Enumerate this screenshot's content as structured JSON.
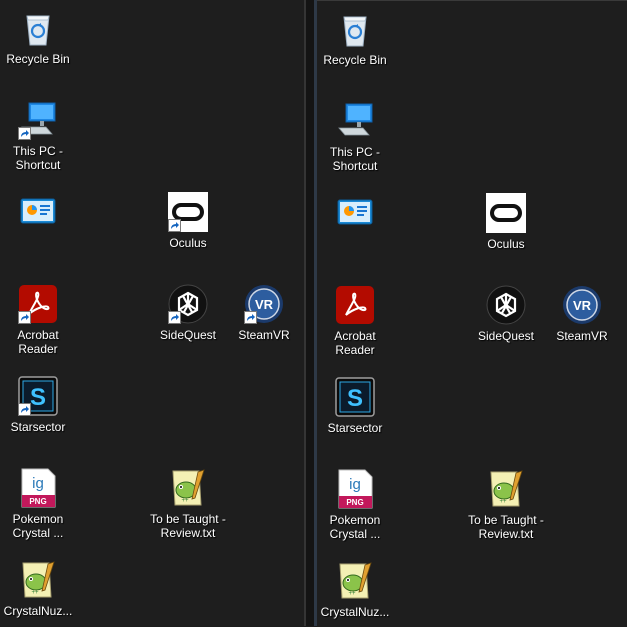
{
  "desktop_left": {
    "icons": [
      {
        "label": "Recycle Bin",
        "icon": "recycle-bin-icon"
      },
      {
        "label": "This PC - Shortcut",
        "icon": "this-pc-icon"
      },
      {
        "label": "",
        "icon": "control-panel-icon"
      },
      {
        "label": "Oculus",
        "icon": "oculus-icon"
      },
      {
        "label": "Acrobat Reader",
        "icon": "acrobat-reader-icon"
      },
      {
        "label": "SideQuest",
        "icon": "sidequest-icon"
      },
      {
        "label": "SteamVR",
        "icon": "steamvr-icon"
      },
      {
        "label": "Starsector",
        "icon": "starsector-icon"
      },
      {
        "label": "Pokemon Crystal ...",
        "icon": "png-file-icon"
      },
      {
        "label": "To be Taught - Review.txt",
        "icon": "notepad-plus-plus-icon"
      },
      {
        "label": "CrystalNuz...",
        "icon": "notepad-plus-plus-icon"
      }
    ]
  },
  "desktop_right": {
    "icons": [
      {
        "label": "Recycle Bin",
        "icon": "recycle-bin-icon"
      },
      {
        "label": "This PC - Shortcut",
        "icon": "this-pc-icon"
      },
      {
        "label": "",
        "icon": "control-panel-icon"
      },
      {
        "label": "Oculus",
        "icon": "oculus-icon"
      },
      {
        "label": "Acrobat Reader",
        "icon": "acrobat-reader-icon"
      },
      {
        "label": "SideQuest",
        "icon": "sidequest-icon"
      },
      {
        "label": "SteamVR",
        "icon": "steamvr-icon"
      },
      {
        "label": "Starsector",
        "icon": "starsector-icon"
      },
      {
        "label": "Pokemon Crystal ...",
        "icon": "png-file-icon"
      },
      {
        "label": "To be Taught - Review.txt",
        "icon": "notepad-plus-plus-icon"
      },
      {
        "label": "CrystalNuz...",
        "icon": "notepad-plus-plus-icon"
      }
    ]
  },
  "colors": {
    "desktop_background": "#1e1e1e",
    "label_text": "#ffffff",
    "acrobat_red": "#b30b00",
    "png_badge": "#c2185b",
    "steamvr_blue": "#1b3a6b"
  }
}
